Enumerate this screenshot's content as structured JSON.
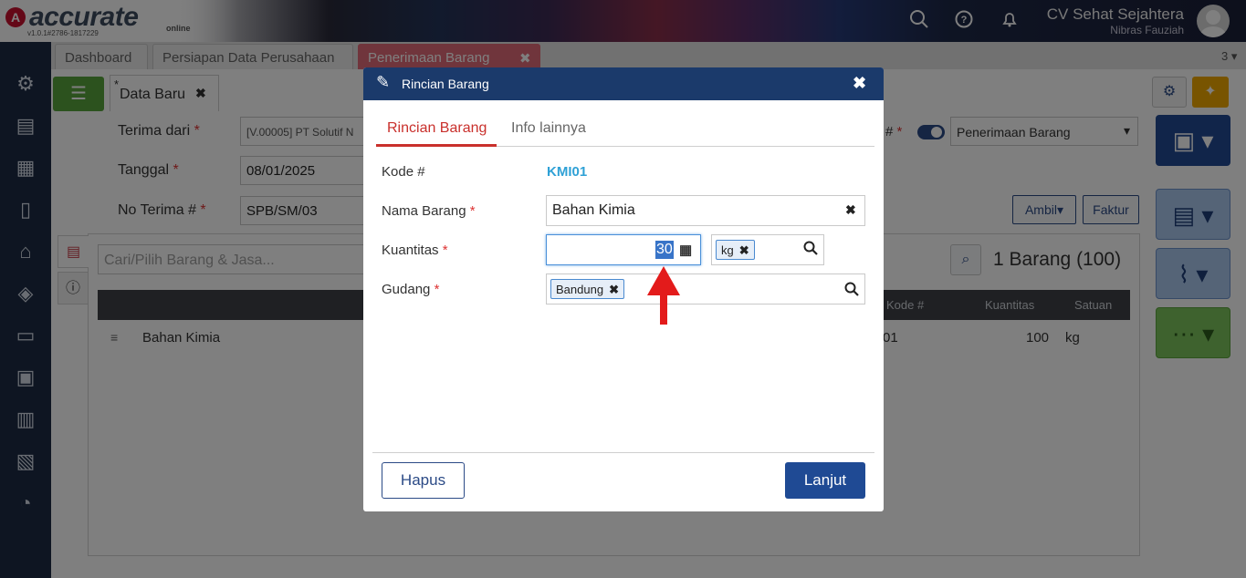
{
  "app": {
    "logo_text": "accurate",
    "logo_sub": "online",
    "version": "v1.0.1#2786-1817229",
    "company": "CV Sehat Sejahtera",
    "user": "Nibras Fauziah"
  },
  "tabs": [
    {
      "label": "Dashboard"
    },
    {
      "label": "Persiapan Data Perusahaan"
    },
    {
      "label": "Penerimaan Barang",
      "close": "✖"
    }
  ],
  "tab_count": "3",
  "subtab": {
    "marker": "*",
    "label": "Data Baru",
    "close": "✖"
  },
  "form": {
    "terima_dari_label": "Terima dari",
    "terima_dari_value": "[V.00005] PT Solutif N",
    "tanggal_label": "Tanggal",
    "tanggal_value": "08/01/2025",
    "no_terima_label": "No Terima #",
    "no_terima_value": "SPB/SM/03",
    "required_mark": "*",
    "hash_mark": "#",
    "tipe_value": "Penerimaan Barang",
    "ambil_label": "Ambil",
    "faktur_label": "Faktur"
  },
  "detail": {
    "search_placeholder": "Cari/Pilih Barang & Jasa...",
    "count_label": "1 Barang (100)",
    "columns": {
      "kode": "Kode #",
      "kuantitas": "Kuantitas",
      "satuan": "Satuan"
    },
    "row": {
      "nama": "Bahan Kimia",
      "kode": "01",
      "kuantitas": "100",
      "satuan": "kg"
    }
  },
  "dialog": {
    "title": "Rincian Barang",
    "close": "✖",
    "tabs": [
      {
        "label": "Rincian Barang"
      },
      {
        "label": "Info lainnya"
      }
    ],
    "kode_label": "Kode #",
    "kode_value": "KMI01",
    "nama_label": "Nama Barang",
    "nama_value": "Bahan Kimia",
    "kuantitas_label": "Kuantitas",
    "kuantitas_value": "30",
    "unit_value": "kg",
    "gudang_label": "Gudang",
    "gudang_value": "Bandung",
    "required_mark": "*",
    "hapus_label": "Hapus",
    "lanjut_label": "Lanjut"
  }
}
